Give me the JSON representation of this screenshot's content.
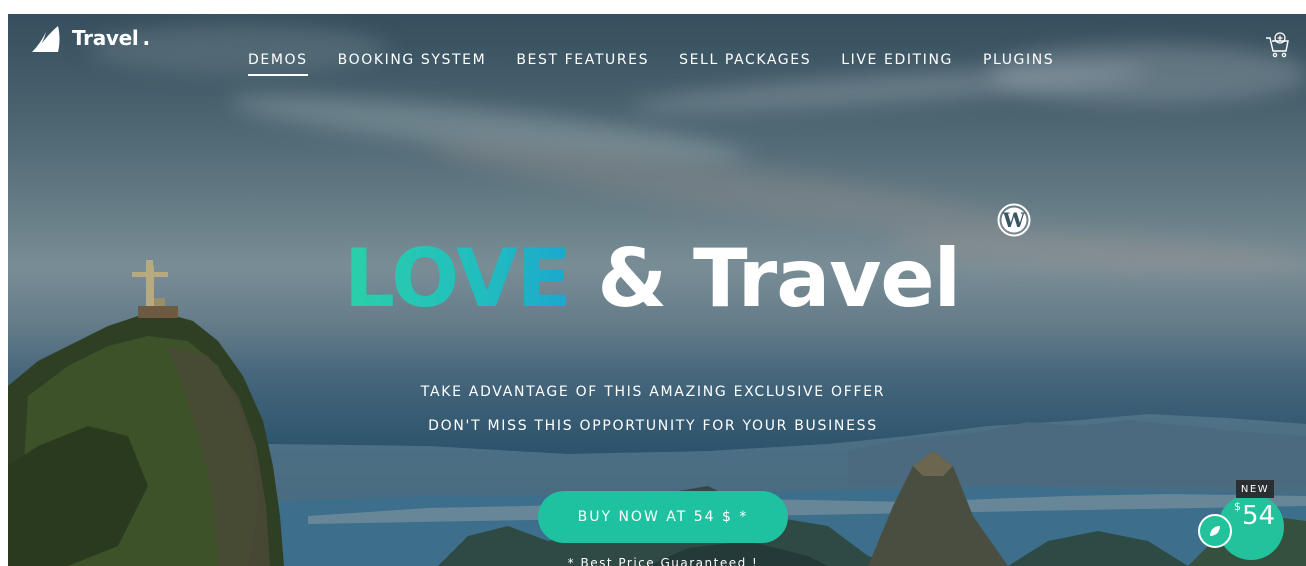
{
  "brand": {
    "name": "Travel",
    "dot": "."
  },
  "nav": {
    "items": [
      {
        "label": "DEMOS",
        "active": true
      },
      {
        "label": "BOOKING SYSTEM",
        "active": false
      },
      {
        "label": "BEST FEATURES",
        "active": false
      },
      {
        "label": "SELL PACKAGES",
        "active": false
      },
      {
        "label": "LIVE EDITING",
        "active": false
      },
      {
        "label": "PLUGINS",
        "active": false
      }
    ],
    "cart_icon": "cart-icon"
  },
  "hero": {
    "headline_accent": "LOVE",
    "headline_rest": " & Travel",
    "subline_1": "TAKE ADVANTAGE OF THIS AMAZING EXCLUSIVE OFFER",
    "subline_2": "DON'T MISS THIS OPPORTUNITY FOR YOUR BUSINESS",
    "cta_label": "BUY NOW AT 54 $ *",
    "price_note": "* Best Price Guaranteed !",
    "platform_icon": "wordpress-icon"
  },
  "badge": {
    "tag": "NEW",
    "currency": "$",
    "price": "54",
    "icon": "leaf-icon"
  },
  "colors": {
    "accent": "#1fc2a0",
    "headline_gradient_start": "#2ad0a8",
    "headline_gradient_end": "#1aa8cf",
    "badge_tag_bg": "#2a2f33"
  }
}
